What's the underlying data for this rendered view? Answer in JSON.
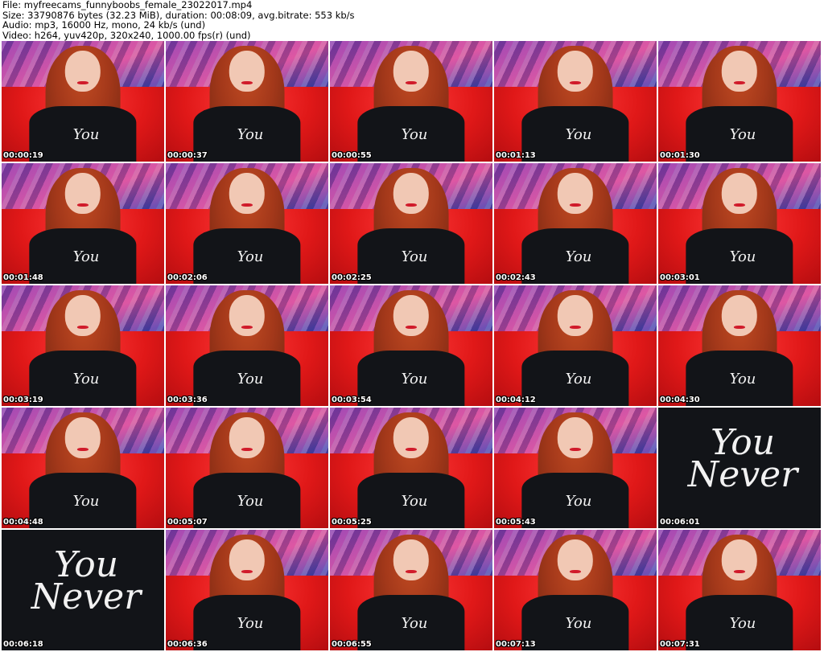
{
  "header": {
    "file_line": "File: myfreecams_funnyboobs_female_23022017.mp4",
    "size_line": "Size: 33790876 bytes (32.23 MiB), duration: 00:08:09, avg.bitrate: 553 kb/s",
    "audio_line": "Audio: mp3, 16000 Hz, mono, 24 kb/s (und)",
    "video_line": "Video: h264, yuv420p, 320x240, 1000.00 fps(r) (und)"
  },
  "thumbnails": [
    {
      "timestamp": "00:00:19",
      "shirt_text": "You"
    },
    {
      "timestamp": "00:00:37",
      "shirt_text": "You"
    },
    {
      "timestamp": "00:00:55",
      "shirt_text": "You"
    },
    {
      "timestamp": "00:01:13",
      "shirt_text": "You"
    },
    {
      "timestamp": "00:01:30",
      "shirt_text": "You"
    },
    {
      "timestamp": "00:01:48",
      "shirt_text": "You"
    },
    {
      "timestamp": "00:02:06",
      "shirt_text": "You"
    },
    {
      "timestamp": "00:02:25",
      "shirt_text": "You"
    },
    {
      "timestamp": "00:02:43",
      "shirt_text": "You"
    },
    {
      "timestamp": "00:03:01",
      "shirt_text": "You"
    },
    {
      "timestamp": "00:03:19",
      "shirt_text": "You"
    },
    {
      "timestamp": "00:03:36",
      "shirt_text": "You"
    },
    {
      "timestamp": "00:03:54",
      "shirt_text": "You"
    },
    {
      "timestamp": "00:04:12",
      "shirt_text": "You"
    },
    {
      "timestamp": "00:04:30",
      "shirt_text": "You"
    },
    {
      "timestamp": "00:04:48",
      "shirt_text": "You"
    },
    {
      "timestamp": "00:05:07",
      "shirt_text": "You"
    },
    {
      "timestamp": "00:05:25",
      "shirt_text": "You"
    },
    {
      "timestamp": "00:05:43",
      "shirt_text": "You"
    },
    {
      "timestamp": "00:06:01",
      "shirt_text": "You Never",
      "closeup": true
    },
    {
      "timestamp": "00:06:18",
      "shirt_text": "You Never",
      "closeup": true
    },
    {
      "timestamp": "00:06:36",
      "shirt_text": "You"
    },
    {
      "timestamp": "00:06:55",
      "shirt_text": "You"
    },
    {
      "timestamp": "00:07:13",
      "shirt_text": "You"
    },
    {
      "timestamp": "00:07:31",
      "shirt_text": "You"
    }
  ]
}
